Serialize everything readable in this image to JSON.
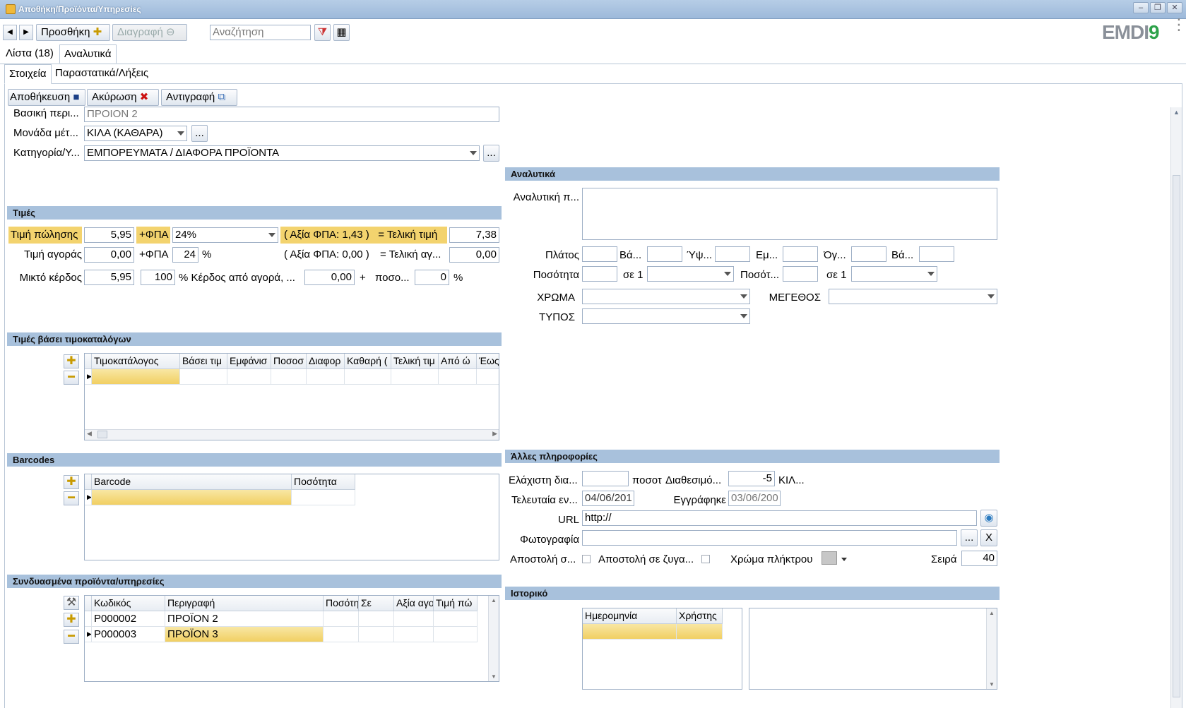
{
  "window": {
    "title": "Αποθήκη/Προϊόντα/Υπηρεσίες"
  },
  "toolbar": {
    "add_label": "Προσθήκη",
    "delete_label": "Διαγραφή",
    "search_placeholder": "Αναζήτηση",
    "logo_text": "EMDI9"
  },
  "main_tabs": [
    {
      "label": "Λίστα (18)"
    },
    {
      "label": "Αναλυτικά"
    }
  ],
  "sub_tabs": [
    {
      "label": "Στοιχεία"
    },
    {
      "label": "Παραστατικά/Λήξεις"
    }
  ],
  "actions": {
    "save_label": "Αποθήκευση",
    "cancel_label": "Ακύρωση",
    "copy_label": "Αντιγραφή"
  },
  "basic": {
    "desc_label": "Βασική περι...",
    "desc_value": "ΠΡΟΙΟΝ 2",
    "unit_label": "Μονάδα μέτ...",
    "unit_value": "ΚΙΛΑ (ΚΑΘΑΡΑ)",
    "category_label": "Κατηγορία/Υ...",
    "category_value": "ΕΜΠΟΡΕΥΜΑΤΑ / ΔΙΑΦΟΡΑ ΠΡΟΪΟΝΤΑ",
    "more": "..."
  },
  "prices": {
    "section": "Τιμές",
    "sell_label": "Τιμή πώλησης",
    "sell_value": "5,95",
    "vat_label": "+ΦΠΑ",
    "vat_value": "24%",
    "sell_vat_amount": "( Αξία ΦΠΑ: 1,43 )",
    "final_label": "= Τελική τιμή",
    "sell_final": "7,38",
    "buy_label": "Τιμή αγοράς",
    "buy_value": "0,00",
    "buy_vat_value": "24",
    "percent": "%",
    "buy_vat_amount": "( Αξία ΦΠΑ: 0,00 )",
    "buy_final_label": "= Τελική αγ...",
    "buy_final": "0,00",
    "profit_label": "Μικτό κέρδος",
    "profit_value": "5,95",
    "profit_pct": "100",
    "profit_from_label": "% Κέρδος από αγορά, ...",
    "profit_from_value": "0,00",
    "plus": "+",
    "amount_label": "ποσο...",
    "amount_value": "0"
  },
  "pricelists": {
    "section": "Τιμές βάσει τιμοκαταλόγων",
    "columns": [
      "Τιμοκατάλογος",
      "Βάσει τιμ",
      "Εμφάνισ",
      "Ποσοσ",
      "Διαφορ",
      "Καθαρή (",
      "Τελική τιμ",
      "Από ώ",
      "Έως"
    ]
  },
  "barcodes": {
    "section": "Barcodes",
    "columns": [
      "Barcode",
      "Ποσότητα"
    ]
  },
  "related": {
    "section": "Συνδυασμένα προϊόντα/υπηρεσίες",
    "columns": [
      "Κωδικός",
      "Περιγραφή",
      "Ποσότη",
      "Σε",
      "Αξία αγο",
      "Τιμή πώ"
    ],
    "rows": [
      {
        "code": "P000002",
        "desc": "ΠΡΟΪΟΝ 2"
      },
      {
        "code": "P000003",
        "desc": "ΠΡΟΪΟΝ 3"
      }
    ]
  },
  "analytics": {
    "section": "Αναλυτικά",
    "desc_label": "Αναλυτική π...",
    "width_label": "Πλάτος",
    "wgt1_label": "Βά...",
    "height_label": "Ύψ...",
    "area_label": "Εμ...",
    "volume_label": "Όγ...",
    "wgt2_label": "Βά...",
    "qty_label": "Ποσότητα",
    "in1_label": "σε 1",
    "qty2_label": "Ποσότ...",
    "in2_label": "σε 1",
    "color_label": "ΧΡΩΜΑ",
    "size_label": "ΜΕΓΕΘΟΣ",
    "type_label": "ΤΥΠΟΣ"
  },
  "other": {
    "section": "Άλλες πληροφορίες",
    "min_label": "Ελάχιστη δια...",
    "pct_label": "ποσοτ",
    "avail_label": "Διαθεσιμό...",
    "avail_value": "-5",
    "avail_unit": "ΚΙΛ...",
    "last_label": "Τελευταία εν...",
    "last_value": "04/06/201",
    "reg_label": "Εγγράφηκε",
    "reg_value": "03/06/200",
    "url_label": "URL",
    "url_value": "http://",
    "photo_label": "Φωτογραφία",
    "photo_clear": "X",
    "send1_label": "Αποστολή σ...",
    "send2_label": "Αποστολή σε ζυγα...",
    "key_color_label": "Χρώμα πλήκτρου",
    "order_label": "Σειρά",
    "order_value": "40"
  },
  "history": {
    "section": "Ιστορικό",
    "columns": [
      "Ημερομηνία",
      "Χρήστης"
    ]
  },
  "colors": {
    "accent": "#f1cf62",
    "section": "#a8c1dc"
  }
}
